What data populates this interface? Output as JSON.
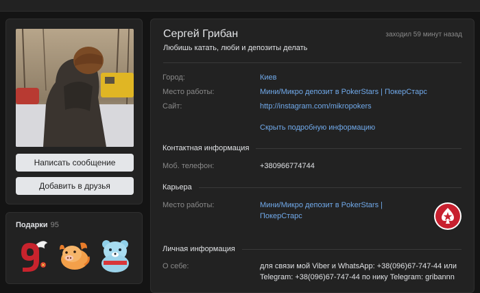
{
  "profile": {
    "name": "Сергей Грибан",
    "last_seen": "заходил 59 минут назад",
    "status": "Любишь катать, люби и депозиты делать"
  },
  "actions": {
    "send_message": "Написать сообщение",
    "add_friend": "Добавить в друзья"
  },
  "gifts": {
    "title": "Подарки",
    "count": "95",
    "items": [
      "number-9-gift-icon",
      "pig-gift-icon",
      "bear-gift-icon"
    ]
  },
  "info": {
    "city_label": "Город:",
    "city_value": "Киев",
    "work_label": "Место работы:",
    "work_value": "Мини/Микро депозит в PokerStars | ПокерСтарс",
    "site_label": "Сайт:",
    "site_value": "http://instagram.com/mikropokers",
    "toggle_details": "Скрыть подробную информацию"
  },
  "contacts": {
    "title": "Контактная информация",
    "phone_label": "Моб. телефон:",
    "phone_value": "+380966774744"
  },
  "career": {
    "title": "Карьера",
    "work_label": "Место работы:",
    "work_value_line1": "Мини/Микро депозит в PokerStars |",
    "work_value_line2": "ПокерСтарс"
  },
  "personal": {
    "title": "Личная информация",
    "about_label": "О себе:",
    "about_line1": "для связи мой Viber и WhatsApp: +38(096)67-747-44 или",
    "about_line2": "Telegram: +38(096)67-747-44 по нику Telegram: gribannn"
  },
  "colors": {
    "background": "#141414",
    "card": "#222222",
    "link": "#71aaeb",
    "muted": "#8a8a8a",
    "button": "#e4e6e9"
  }
}
